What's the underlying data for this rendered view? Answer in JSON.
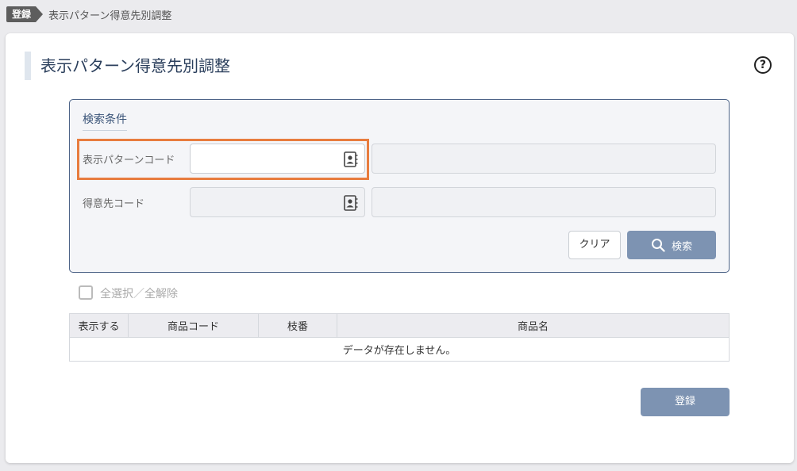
{
  "breadcrumb": {
    "tag": "登録",
    "text": "表示パターン得意先別調整"
  },
  "page": {
    "title": "表示パターン得意先別調整",
    "help_glyph": "?"
  },
  "search": {
    "panel_title": "検索条件",
    "pattern_code": {
      "label": "表示パターンコード",
      "value": "",
      "name_value": ""
    },
    "customer_code": {
      "label": "得意先コード",
      "value": "",
      "name_value": ""
    },
    "clear_label": "クリア",
    "search_label": "検索"
  },
  "select_all_label": "全選択／全解除",
  "table": {
    "columns": [
      "表示する",
      "商品コード",
      "枝番",
      "商品名"
    ],
    "empty_message": "データが存在しません。"
  },
  "register_label": "登録",
  "colors": {
    "accent": "#7d93b2",
    "highlight": "#e87c3e",
    "panel_border": "#4e6488"
  },
  "icons": [
    "contact-book-icon",
    "search-icon",
    "help-icon"
  ]
}
